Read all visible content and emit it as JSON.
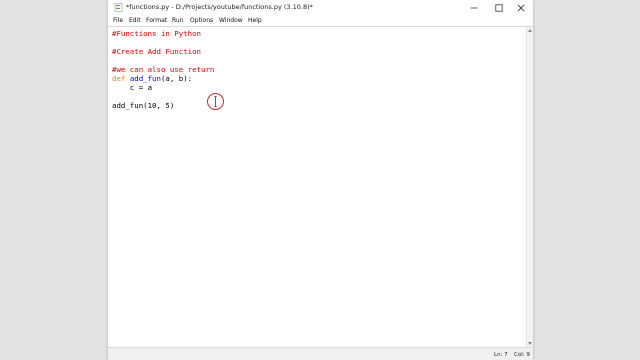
{
  "window": {
    "title": "*functions.py - D:/Projects/youtube/functions.py (3.10.8)*"
  },
  "menu": {
    "items": [
      "File",
      "Edit",
      "Format",
      "Run",
      "Options",
      "Window",
      "Help"
    ]
  },
  "editor": {
    "lines": [
      {
        "segments": [
          {
            "text": "#Functions in Python",
            "type": "comment"
          }
        ]
      },
      {
        "segments": []
      },
      {
        "segments": [
          {
            "text": "#Create Add Function",
            "type": "comment"
          }
        ]
      },
      {
        "segments": []
      },
      {
        "segments": [
          {
            "text": "#we can also use return",
            "type": "comment"
          }
        ]
      },
      {
        "segments": [
          {
            "text": "def",
            "type": "keyword"
          },
          {
            "text": " ",
            "type": "plain"
          },
          {
            "text": "add_fun",
            "type": "def"
          },
          {
            "text": "(a, b):",
            "type": "plain"
          }
        ]
      },
      {
        "segments": [
          {
            "text": "    c = a",
            "type": "plain"
          }
        ]
      },
      {
        "segments": []
      },
      {
        "segments": [
          {
            "text": "add_fun(10, 5)",
            "type": "plain"
          }
        ]
      }
    ]
  },
  "status": {
    "line": "Ln: 7",
    "column": "Col: 9"
  },
  "colors": {
    "comment": "#dd0000",
    "keyword": "#ff7700",
    "definition": "#0000ff",
    "cursor_ring": "#c0302a"
  },
  "icons": {
    "app": "python-idle-icon",
    "minimize": "minimize-icon",
    "maximize": "maximize-icon",
    "close": "close-icon",
    "pointer": "text-cursor-icon"
  }
}
